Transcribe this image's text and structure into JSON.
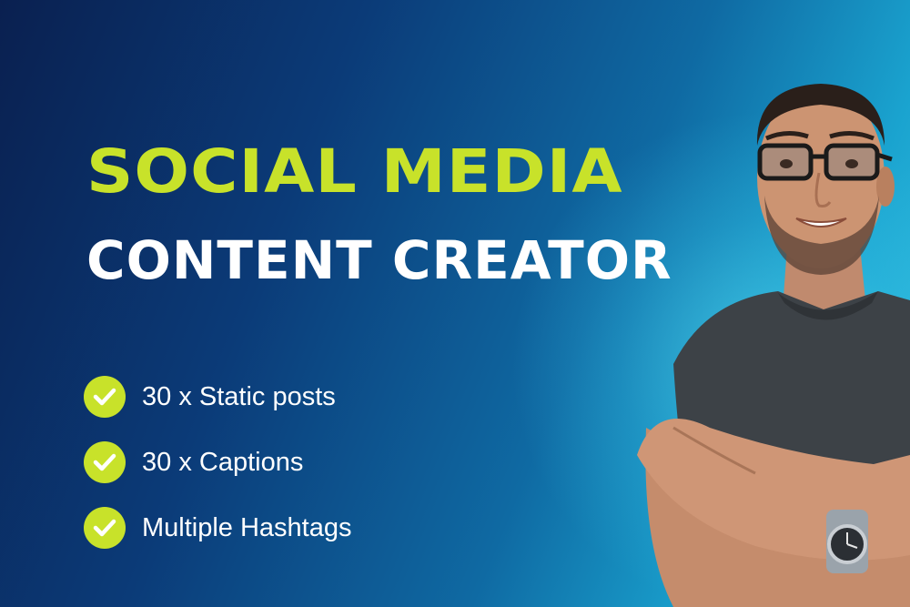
{
  "title": {
    "line1": "SOCIAL MEDIA",
    "line2": "CONTENT CREATOR"
  },
  "features": [
    {
      "label": "30 x Static posts",
      "icon": "check-icon"
    },
    {
      "label": "30 x Captions",
      "icon": "check-icon"
    },
    {
      "label": "Multiple Hashtags",
      "icon": "check-icon"
    }
  ],
  "colors": {
    "accent": "#c8e22a",
    "background_dark": "#0a2050",
    "background_light": "#38c6e4",
    "text": "#ffffff"
  }
}
